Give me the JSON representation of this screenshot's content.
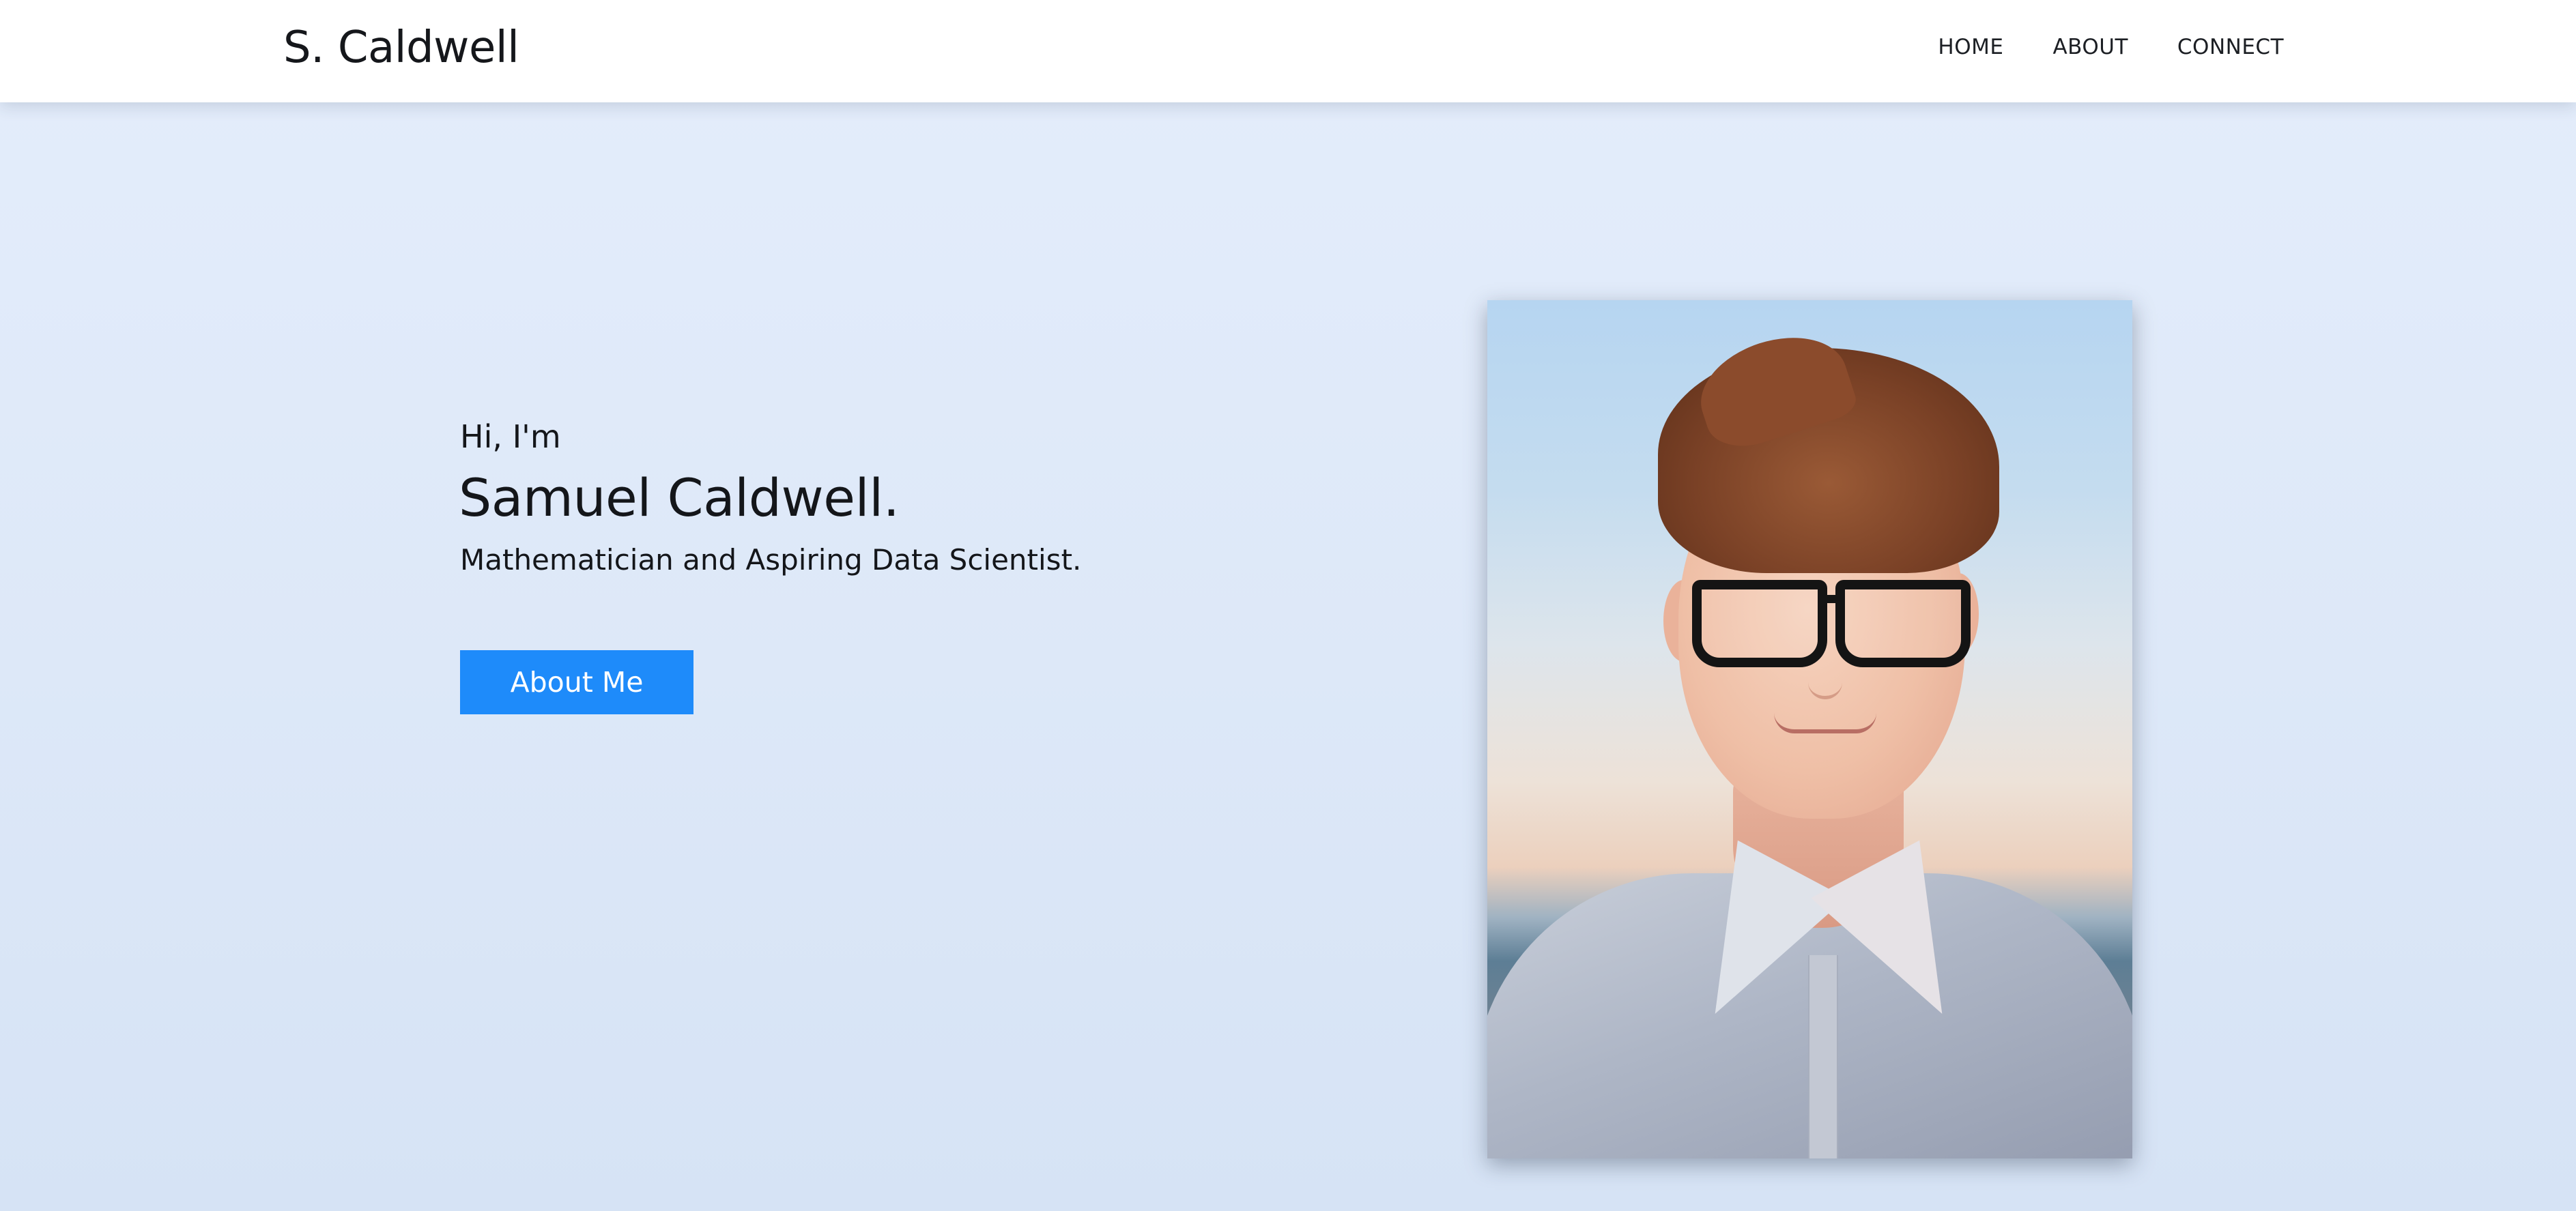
{
  "header": {
    "brand": "S. Caldwell",
    "nav": [
      {
        "label": "HOME"
      },
      {
        "label": "ABOUT"
      },
      {
        "label": "CONNECT"
      }
    ]
  },
  "hero": {
    "greeting": "Hi, I'm",
    "name": "Samuel Caldwell.",
    "tagline": "Mathematician and Aspiring Data Scientist.",
    "button_label": "About Me",
    "portrait_alt": "Portrait of Samuel Caldwell"
  },
  "colors": {
    "accent": "#1e8bfa",
    "background": "#e0eaf9",
    "header_bg": "#ffffff",
    "text": "#14161a"
  }
}
